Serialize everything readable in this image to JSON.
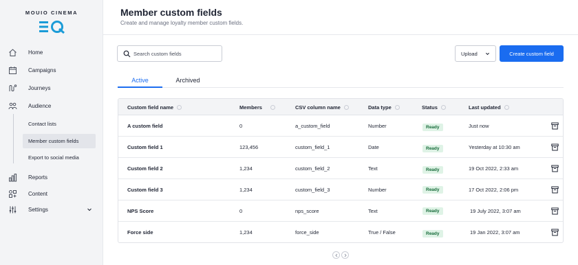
{
  "brand": {
    "name": "MOUIO CINEMA"
  },
  "nav": {
    "home": "Home",
    "campaigns": "Campaigns",
    "journeys": "Journeys",
    "audience": "Audience",
    "contact_lists": "Contact lists",
    "member_custom_fields": "Member custom fields",
    "export_to_social_media": "Export to social media",
    "reports": "Reports",
    "content": "Content",
    "settings": "Settings"
  },
  "header": {
    "title": "Member custom fields",
    "subtitle": "Create and manage loyalty member custom fields."
  },
  "toolbar": {
    "search_placeholder": "Search custom fields",
    "upload_label": "Upload",
    "create_label": "Create custom field"
  },
  "tabs": {
    "active": "Active",
    "archived": "Archived"
  },
  "table": {
    "columns": {
      "name": "Custom field name",
      "members": "Members",
      "csv": "CSV column name",
      "type": "Data type",
      "status": "Status",
      "updated": "Last updated"
    },
    "rows": [
      {
        "name": "A custom field",
        "members": "0",
        "csv": "a_custom_field",
        "type": "Number",
        "status": "Ready",
        "updated": "Just now"
      },
      {
        "name": "Custom field 1",
        "members": "123,456",
        "csv": "custom_field_1",
        "type": "Date",
        "status": "Ready",
        "updated": "Yesterday at 10:30 am"
      },
      {
        "name": "Custom field 2",
        "members": "1,234",
        "csv": "custom_field_2",
        "type": "Text",
        "status": "Ready",
        "updated": "19 Oct 2022, 2:33 am"
      },
      {
        "name": "Custom field 3",
        "members": "1,234",
        "csv": "custom_field_3",
        "type": "Number",
        "status": "Ready",
        "updated": "17 Oct 2022, 2:06 pm"
      },
      {
        "name": "NPS Score",
        "members": "0",
        "csv": "nps_score",
        "type": "Text",
        "status": "Ready",
        "updated": "19 July 2022, 3:07 am"
      },
      {
        "name": "Force side",
        "members": "1,234",
        "csv": "force_side",
        "type": "True / False",
        "status": "Ready",
        "updated": "19 Jan 2022, 3:07 am"
      }
    ]
  },
  "colors": {
    "accent": "#1a6cf0",
    "badge_bg": "#dff3e6",
    "badge_text": "#176b3a",
    "sidebar_bg": "#f3f4f6"
  }
}
